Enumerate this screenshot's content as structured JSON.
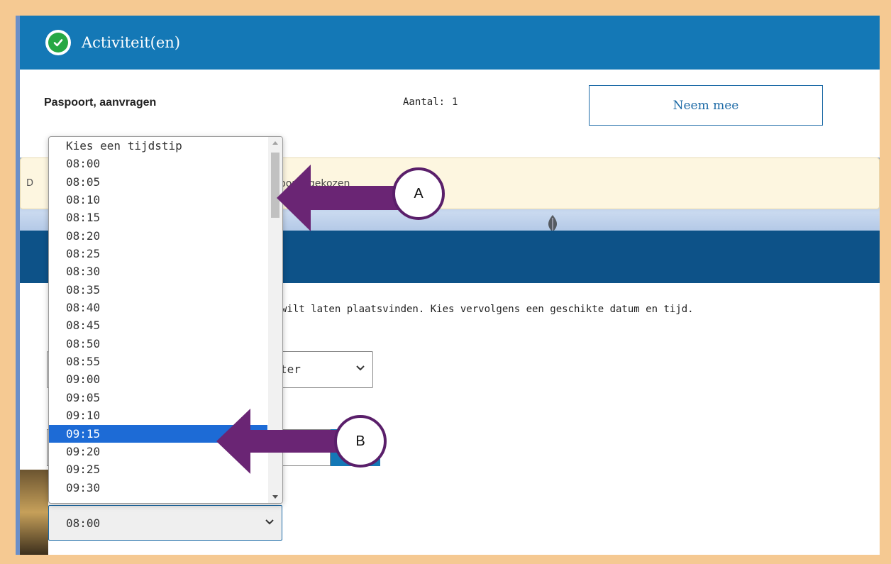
{
  "header": {
    "title": "Activiteit(en)",
    "icon": "check-circle-icon",
    "icon_color": "#27a844",
    "color": "#1478b6"
  },
  "activity": {
    "name": "Paspoort, aanvragen",
    "amount_label": "Aantal:",
    "amount_value": "1",
    "take_button": "Neem mee"
  },
  "notice": {
    "prefix": "D",
    "text": "al voor u gekozen"
  },
  "instructions": "wilt laten plaatsvinden. Kies vervolgens een geschikte datum en tijd.",
  "location_select": {
    "value": "ter"
  },
  "time_select": {
    "value": "08:00"
  },
  "dropdown": {
    "options": [
      "Kies een tijdstip",
      "08:00",
      "08:05",
      "08:10",
      "08:15",
      "08:20",
      "08:25",
      "08:30",
      "08:35",
      "08:40",
      "08:45",
      "08:50",
      "08:55",
      "09:00",
      "09:05",
      "09:10",
      "09:15",
      "09:20",
      "09:25",
      "09:30"
    ],
    "selected": "09:15",
    "selected_color": "#1d6bd6"
  },
  "annotations": [
    {
      "label": "A",
      "color": "#5a1f6a"
    },
    {
      "label": "B",
      "color": "#5a1f6a"
    }
  ]
}
